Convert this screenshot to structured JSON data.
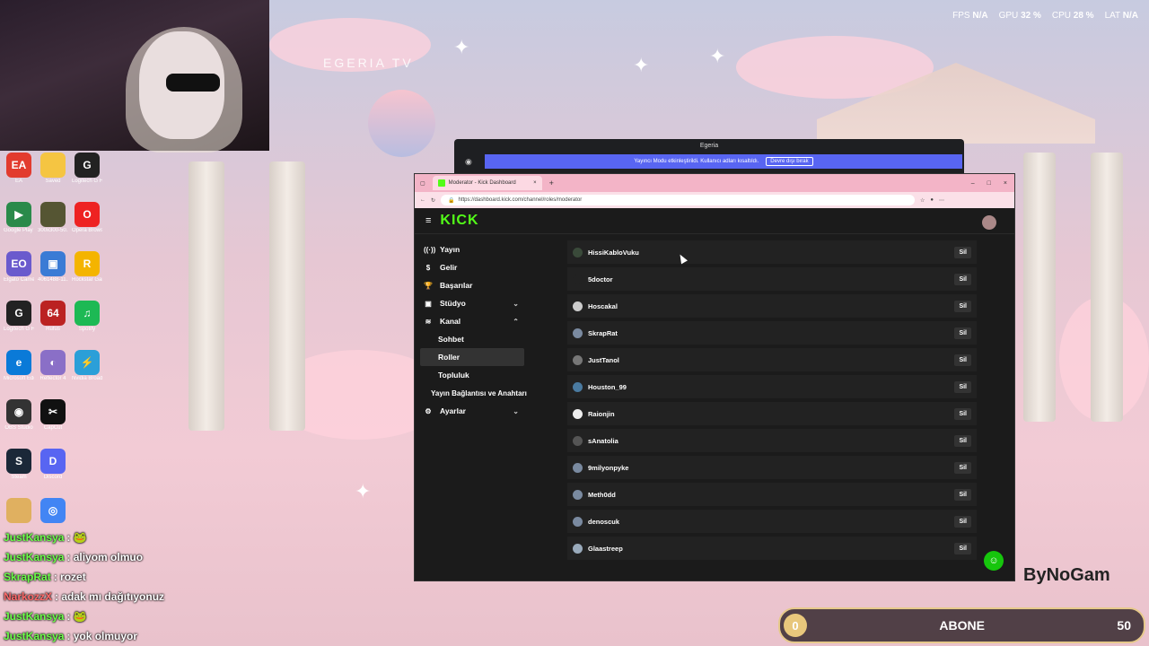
{
  "stats": {
    "fps_label": "FPS",
    "fps": "N/A",
    "gpu_label": "GPU",
    "gpu": "32 %",
    "cpu_label": "CPU",
    "cpu": "28 %",
    "lat_label": "LAT",
    "lat": "N/A"
  },
  "watermark": "EGERIA TV",
  "desktop_icons": [
    {
      "label": "EA",
      "glyph": "EA",
      "color": "#e23b2e"
    },
    {
      "label": "Saved",
      "glyph": "",
      "color": "#f5c542"
    },
    {
      "label": "Logitech G HUB",
      "glyph": "G",
      "color": "#222"
    },
    {
      "label": "Google Play Games Beta",
      "glyph": "▶",
      "color": "#2a8a4a"
    },
    {
      "label": "300x300-50...",
      "glyph": "",
      "color": "#553"
    },
    {
      "label": "Opera Browser",
      "glyph": "O",
      "color": "#e22"
    },
    {
      "label": "Elgato Camera Hub",
      "glyph": "EO",
      "color": "#6a5acd"
    },
    {
      "label": "4061488-11...",
      "glyph": "▣",
      "color": "#3a7bd5"
    },
    {
      "label": "Rockstar Games",
      "glyph": "R",
      "color": "#f4b400"
    },
    {
      "label": "Logitech G HUB",
      "glyph": "G",
      "color": "#222"
    },
    {
      "label": "Rufus",
      "glyph": "64",
      "color": "#b22"
    },
    {
      "label": "Spotify",
      "glyph": "♫",
      "color": "#1db954"
    },
    {
      "label": "Microsoft Edge",
      "glyph": "e",
      "color": "#0a7ad8"
    },
    {
      "label": "Reflector 4",
      "glyph": "◐",
      "color": "#8a6fc7"
    },
    {
      "label": "Nvidia Broadcast",
      "glyph": "⚡",
      "color": "#2b9fd8"
    },
    {
      "label": "OBS Studio",
      "glyph": "◉",
      "color": "#333"
    },
    {
      "label": "CapCut",
      "glyph": "✂",
      "color": "#111"
    },
    {
      "label": "Steam",
      "glyph": "S",
      "color": "#1b2838"
    },
    {
      "label": "Discord",
      "glyph": "D",
      "color": "#5865f2"
    },
    {
      "label": "",
      "glyph": "",
      "color": "#e0b060"
    },
    {
      "label": "",
      "glyph": "◎",
      "color": "#4285f4"
    }
  ],
  "chat": [
    {
      "user": "JustKansya",
      "user_color": "#6cff4a",
      "msg": ": 🐸"
    },
    {
      "user": "JustKansya",
      "user_color": "#6cff4a",
      "msg": ": aliyom olmuo"
    },
    {
      "user": "SkrapRat",
      "user_color": "#6cff4a",
      "msg": ": rozet"
    },
    {
      "user": "NarkozzX",
      "user_color": "#ff6a6a",
      "msg": ": adak mı dağıtıyonuz"
    },
    {
      "user": "JustKansya",
      "user_color": "#6cff4a",
      "msg": ": 🐸"
    },
    {
      "user": "JustKansya",
      "user_color": "#6cff4a",
      "msg": ": yok olmuyor"
    }
  ],
  "discord": {
    "title": "Egeria",
    "banner_text": "Yayıncı Modu etkinleştirildi. Kullanıcı adları kısaltıldı.",
    "banner_button": "Devre dışı bırak"
  },
  "browser": {
    "tab_title": "Moderator - Kick Dashboard",
    "url": "https://dashboard.kick.com/channel/roles/moderator"
  },
  "kick": {
    "logo": "KICK",
    "nav": [
      {
        "label": "Yayın",
        "icon": "((·))",
        "type": "main",
        "chevron": ""
      },
      {
        "label": "Gelir",
        "icon": "$",
        "type": "main",
        "chevron": ""
      },
      {
        "label": "Başarılar",
        "icon": "🏆",
        "type": "main",
        "chevron": ""
      },
      {
        "label": "Stüdyo",
        "icon": "▣",
        "type": "main",
        "chevron": "⌄"
      },
      {
        "label": "Kanal",
        "icon": "≋",
        "type": "main",
        "chevron": "⌃"
      },
      {
        "label": "Sohbet",
        "icon": "",
        "type": "sub",
        "chevron": ""
      },
      {
        "label": "Roller",
        "icon": "",
        "type": "active",
        "chevron": ""
      },
      {
        "label": "Topluluk",
        "icon": "",
        "type": "sub",
        "chevron": ""
      },
      {
        "label": "Yayın Bağlantısı ve Anahtarı",
        "icon": "",
        "type": "sub2",
        "chevron": ""
      },
      {
        "label": "Ayarlar",
        "icon": "⚙",
        "type": "main",
        "chevron": "⌄"
      }
    ],
    "moderators": [
      {
        "name": "HissiKabloVuku",
        "color": "#3a4a3a"
      },
      {
        "name": "5doctor",
        "color": "#222"
      },
      {
        "name": "Hoscakal",
        "color": "#ccc"
      },
      {
        "name": "SkrapRat",
        "color": "#7a8aa0"
      },
      {
        "name": "JustTanol",
        "color": "#777"
      },
      {
        "name": "Houston_99",
        "color": "#4a7aa0"
      },
      {
        "name": "Raionjin",
        "color": "#eee"
      },
      {
        "name": "sAnatolia",
        "color": "#555"
      },
      {
        "name": "9milyonpyke",
        "color": "#7a8aa0"
      },
      {
        "name": "Meth0dd",
        "color": "#7a8aa0"
      },
      {
        "name": "denoscuk",
        "color": "#7a8aa0"
      },
      {
        "name": "Glaastreep",
        "color": "#9ab"
      }
    ],
    "delete_label": "Sil"
  },
  "subgoal": {
    "current": "0",
    "label": "ABONE",
    "target": "50",
    "progress": 0
  },
  "brand": "ByNoGam"
}
